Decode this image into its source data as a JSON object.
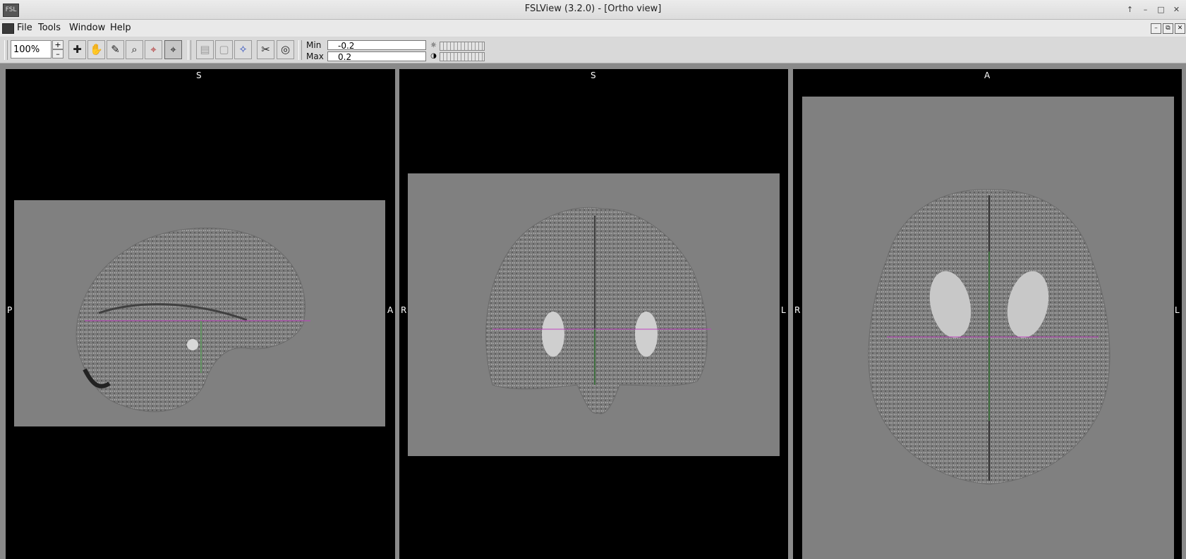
{
  "window": {
    "title": "FSLView (3.2.0) - [Ortho view]",
    "app_icon_text": "FSL",
    "controls": [
      "↑",
      "–",
      "□",
      "✕"
    ]
  },
  "menubar": {
    "items": [
      {
        "label": "File"
      },
      {
        "label": "Tools"
      },
      {
        "label": "Window"
      },
      {
        "label": "Help"
      }
    ],
    "mdi_controls": [
      "–",
      "⧉",
      "✕"
    ]
  },
  "toolbar": {
    "zoom": "100%",
    "zoom_plus": "+",
    "zoom_minus": "–",
    "tools": [
      {
        "name": "cursor-tool",
        "glyph": "✚",
        "active": false
      },
      {
        "name": "pan-tool",
        "glyph": "✋",
        "active": false
      },
      {
        "name": "pen-tool",
        "glyph": "✎",
        "active": false
      },
      {
        "name": "zoom-in-tool",
        "glyph": "⌕",
        "active": false
      },
      {
        "name": "zoom-out-tool",
        "glyph": "⌖",
        "active": false
      },
      {
        "name": "crosshair-tool",
        "glyph": "⌖",
        "active": true
      },
      {
        "name": "mask-tool",
        "glyph": "▤",
        "active": false,
        "disabled": true
      },
      {
        "name": "fill-tool",
        "glyph": "▢",
        "active": false,
        "disabled": true
      },
      {
        "name": "cluster-tool",
        "glyph": "✧",
        "active": false
      },
      {
        "name": "cut-tool",
        "glyph": "✂",
        "active": false
      },
      {
        "name": "binoculars-tool",
        "glyph": "◎",
        "active": false
      }
    ],
    "min_label": "Min",
    "min_value": "-0.2",
    "max_label": "Max",
    "max_value": "0.2"
  },
  "views": {
    "sagittal": {
      "top": "S",
      "left": "P",
      "right": "A"
    },
    "coronal": {
      "top": "S",
      "left": "R",
      "right": "L"
    },
    "axial": {
      "top": "A",
      "left": "R",
      "right": "L"
    }
  },
  "colors": {
    "background_gray": "#808080",
    "crosshair_h": "#c040c0",
    "crosshair_v": "#40a040"
  }
}
